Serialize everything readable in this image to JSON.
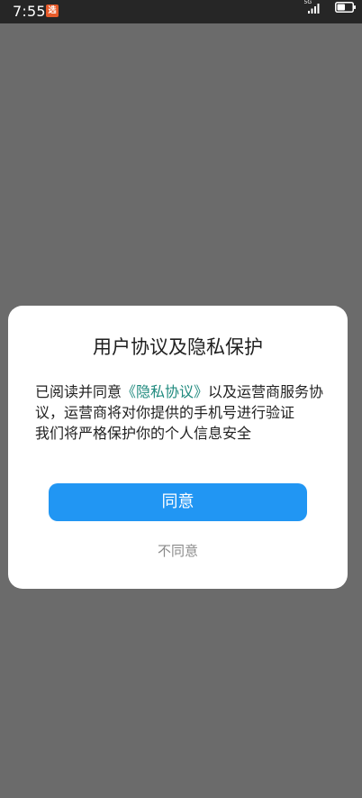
{
  "status_bar": {
    "time": "7:55",
    "app_badge": "选",
    "network_label": "5G"
  },
  "dialog": {
    "title": "用户协议及隐私保护",
    "body": {
      "prefix": "已阅读并同意",
      "privacy_link": "《隐私协议》",
      "suffix": "以及运营商服务协议，运营商将对你提供的手机号进行验证",
      "line2": "我们将严格保护你的个人信息安全"
    },
    "agree_label": "同意",
    "disagree_label": "不同意"
  },
  "colors": {
    "overlay": "#6b6b6b",
    "accent": "#2196f3",
    "link": "#1f8a7e"
  }
}
